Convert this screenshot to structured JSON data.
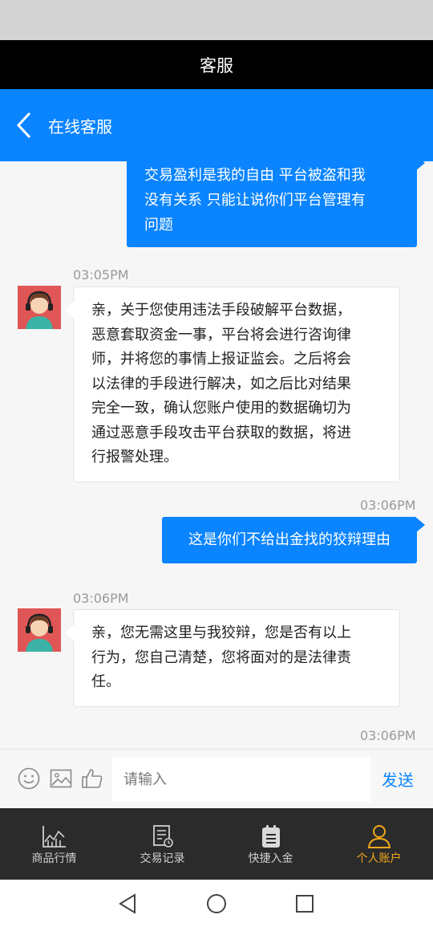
{
  "header": {
    "title": "客服"
  },
  "nav": {
    "title": "在线客服"
  },
  "messages": [
    {
      "role": "me",
      "text_lines": [
        "交易盈利是我的自由 平台被盗和我",
        "没有关系 只能让说你们平台管理有",
        "问题"
      ]
    },
    {
      "role": "agent",
      "time": "03:05PM",
      "text_lines": [
        "亲，关于您使用违法手段破解平台数据，",
        "恶意套取资金一事，平台将会进行咨询律",
        "师，并将您的事情上报证监会。之后将会",
        "以法律的手段进行解决，如之后比对结果",
        "完全一致，确认您账户使用的数据确切为",
        "通过恶意手段攻击平台获取的数据，将进",
        "行报警处理。"
      ]
    },
    {
      "role": "me",
      "time": "03:06PM",
      "text_lines": [
        "这是你们不给出金找的狡辩理由"
      ]
    },
    {
      "role": "agent",
      "time": "03:06PM",
      "text_lines": [
        "亲，您无需这里与我狡辩，您是否有以上",
        "行为，您自己清楚，您将面对的是法律责",
        "任。"
      ]
    },
    {
      "role": "me",
      "time": "03:06PM",
      "text_lines": []
    }
  ],
  "input": {
    "placeholder": "请输入",
    "send_label": "发送"
  },
  "tabs": [
    {
      "label": "商品行情",
      "icon": "chart-icon",
      "active": false
    },
    {
      "label": "交易记录",
      "icon": "record-icon",
      "active": false
    },
    {
      "label": "快捷入金",
      "icon": "clipboard-icon",
      "active": false
    },
    {
      "label": "个人账户",
      "icon": "person-icon",
      "active": true
    }
  ],
  "colors": {
    "accent": "#0a84ff",
    "active_tab": "#f1a81a",
    "tabbar_bg": "#2b2b2b"
  }
}
